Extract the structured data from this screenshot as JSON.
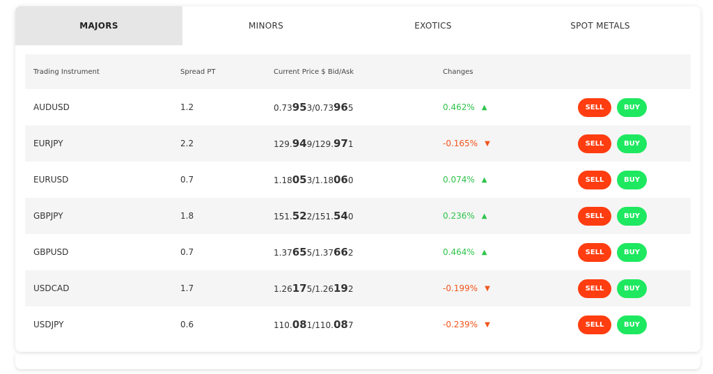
{
  "tabs": [
    {
      "label": "MAJORS",
      "active": true
    },
    {
      "label": "MINORS",
      "active": false
    },
    {
      "label": "EXOTICS",
      "active": false
    },
    {
      "label": "SPOT METALS",
      "active": false
    }
  ],
  "table": {
    "headers": {
      "instrument": "Trading Instrument",
      "spread": "Spread PT",
      "price": "Current Price $ Bid/Ask",
      "changes": "Changes"
    },
    "sell_label": "SELL",
    "buy_label": "BUY",
    "rows": [
      {
        "instrument": "AUDUSD",
        "spread": "1.2",
        "bid_pre": "0.73",
        "bid_big": "95",
        "bid_post": "3",
        "ask_pre": "0.73",
        "ask_big": "96",
        "ask_post": "5",
        "change": "0.462%",
        "direction": "up"
      },
      {
        "instrument": "EURJPY",
        "spread": "2.2",
        "bid_pre": "129.",
        "bid_big": "94",
        "bid_post": "9",
        "ask_pre": "129.",
        "ask_big": "97",
        "ask_post": "1",
        "change": "-0.165%",
        "direction": "down"
      },
      {
        "instrument": "EURUSD",
        "spread": "0.7",
        "bid_pre": "1.18",
        "bid_big": "05",
        "bid_post": "3",
        "ask_pre": "1.18",
        "ask_big": "06",
        "ask_post": "0",
        "change": "0.074%",
        "direction": "up"
      },
      {
        "instrument": "GBPJPY",
        "spread": "1.8",
        "bid_pre": "151.",
        "bid_big": "52",
        "bid_post": "2",
        "ask_pre": "151.",
        "ask_big": "54",
        "ask_post": "0",
        "change": "0.236%",
        "direction": "up"
      },
      {
        "instrument": "GBPUSD",
        "spread": "0.7",
        "bid_pre": "1.37",
        "bid_big": "65",
        "bid_post": "5",
        "ask_pre": "1.37",
        "ask_big": "66",
        "ask_post": "2",
        "change": "0.464%",
        "direction": "up"
      },
      {
        "instrument": "USDCAD",
        "spread": "1.7",
        "bid_pre": "1.26",
        "bid_big": "17",
        "bid_post": "5",
        "ask_pre": "1.26",
        "ask_big": "19",
        "ask_post": "2",
        "change": "-0.199%",
        "direction": "down"
      },
      {
        "instrument": "USDJPY",
        "spread": "0.6",
        "bid_pre": "110.",
        "bid_big": "08",
        "bid_post": "1",
        "ask_pre": "110.",
        "ask_big": "08",
        "ask_post": "7",
        "change": "-0.239%",
        "direction": "down"
      }
    ]
  },
  "colors": {
    "positive": "#2ec34a",
    "negative": "#f2541b",
    "sell": "#ff3d10",
    "buy": "#1ee860"
  },
  "icons": {
    "up": "triangle-up-icon",
    "down": "triangle-down-icon"
  }
}
